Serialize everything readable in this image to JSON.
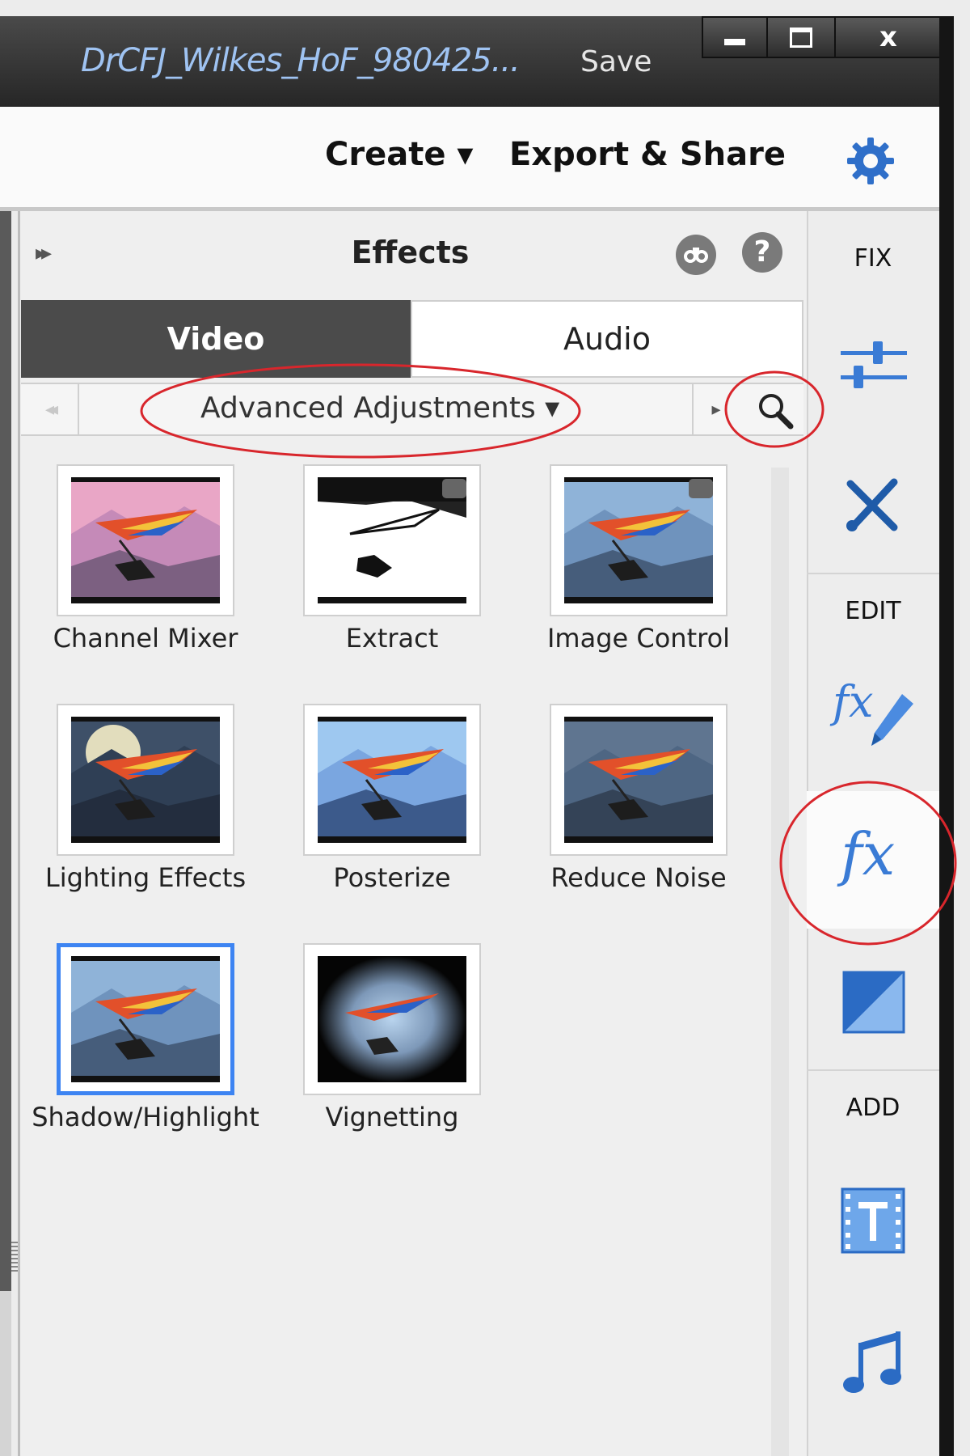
{
  "window": {
    "document_title": "DrCFJ_Wilkes_HoF_980425...",
    "save_label": "Save",
    "close_glyph": "x"
  },
  "menu": {
    "create_label": "Create ▾",
    "export_label": "Export & Share"
  },
  "panel": {
    "title": "Effects",
    "collapse_glyph": "▸▸",
    "help_glyph": "?",
    "tabs": [
      {
        "label": "Video",
        "active": true
      },
      {
        "label": "Audio",
        "active": false
      }
    ],
    "category": {
      "label": "Advanced Adjustments ▾"
    },
    "prev_glyph": "◂◂",
    "next_glyph": "▸"
  },
  "effects": [
    {
      "label": "Channel Mixer",
      "variant": "pink",
      "premium": false,
      "selected": false
    },
    {
      "label": "Extract",
      "variant": "extract",
      "premium": true,
      "selected": false
    },
    {
      "label": "Image Control",
      "variant": "normal",
      "premium": true,
      "selected": false
    },
    {
      "label": "Lighting Effects",
      "variant": "lighting",
      "premium": false,
      "selected": false
    },
    {
      "label": "Posterize",
      "variant": "posterize",
      "premium": false,
      "selected": false
    },
    {
      "label": "Reduce Noise",
      "variant": "noise",
      "premium": false,
      "selected": false
    },
    {
      "label": "Shadow/Highlight",
      "variant": "normal",
      "premium": false,
      "selected": true
    },
    {
      "label": "Vignetting",
      "variant": "vignette",
      "premium": false,
      "selected": false
    }
  ],
  "rightbar": {
    "fix_label": "FIX",
    "edit_label": "EDIT",
    "add_label": "ADD",
    "fx_text": "fx"
  },
  "colors": {
    "accent": "#3a7bd5",
    "annotation": "#d8262c",
    "selected_border": "#3d84f2"
  }
}
